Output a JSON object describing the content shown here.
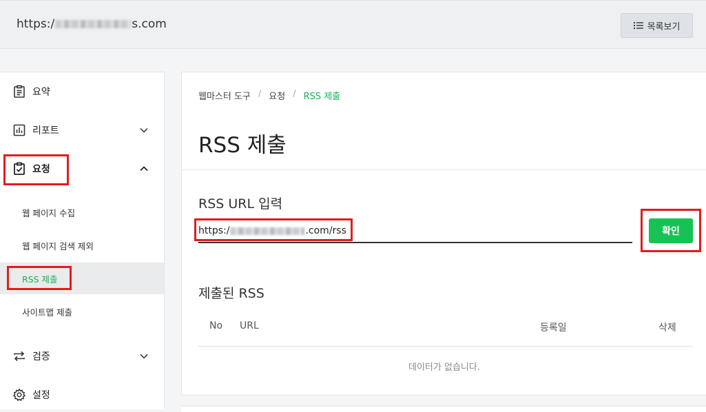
{
  "topbar": {
    "url_prefix": "https:/",
    "url_suffix": "s.com",
    "list_button": "목록보기"
  },
  "sidebar": {
    "items": [
      {
        "label": "요약",
        "icon": "clipboard-list-icon"
      },
      {
        "label": "리포트",
        "icon": "bar-chart-icon"
      },
      {
        "label": "요청",
        "icon": "clipboard-check-icon"
      },
      {
        "label": "검증",
        "icon": "repeat-icon"
      },
      {
        "label": "설정",
        "icon": "gear-icon"
      }
    ],
    "sub_items": [
      {
        "label": "웹 페이지 수집"
      },
      {
        "label": "웹 페이지 검색 제외"
      },
      {
        "label": "RSS 제출"
      },
      {
        "label": "사이트맵 제출"
      }
    ]
  },
  "main": {
    "breadcrumb": [
      "웹마스터 도구",
      "요청",
      "RSS 제출"
    ],
    "breadcrumb_sep": "/",
    "title": "RSS 제출",
    "input_section_title": "RSS URL 입력",
    "input_prefix": "https:/",
    "input_suffix": ".com/rss",
    "confirm_button": "확인",
    "submitted_title": "제출된 RSS",
    "table_headers": [
      "No",
      "URL",
      "등록일",
      "삭제"
    ],
    "empty_message": "데이터가 없습니다."
  },
  "colors": {
    "accent_green": "#17c254",
    "highlight_red": "#e21b1b"
  }
}
